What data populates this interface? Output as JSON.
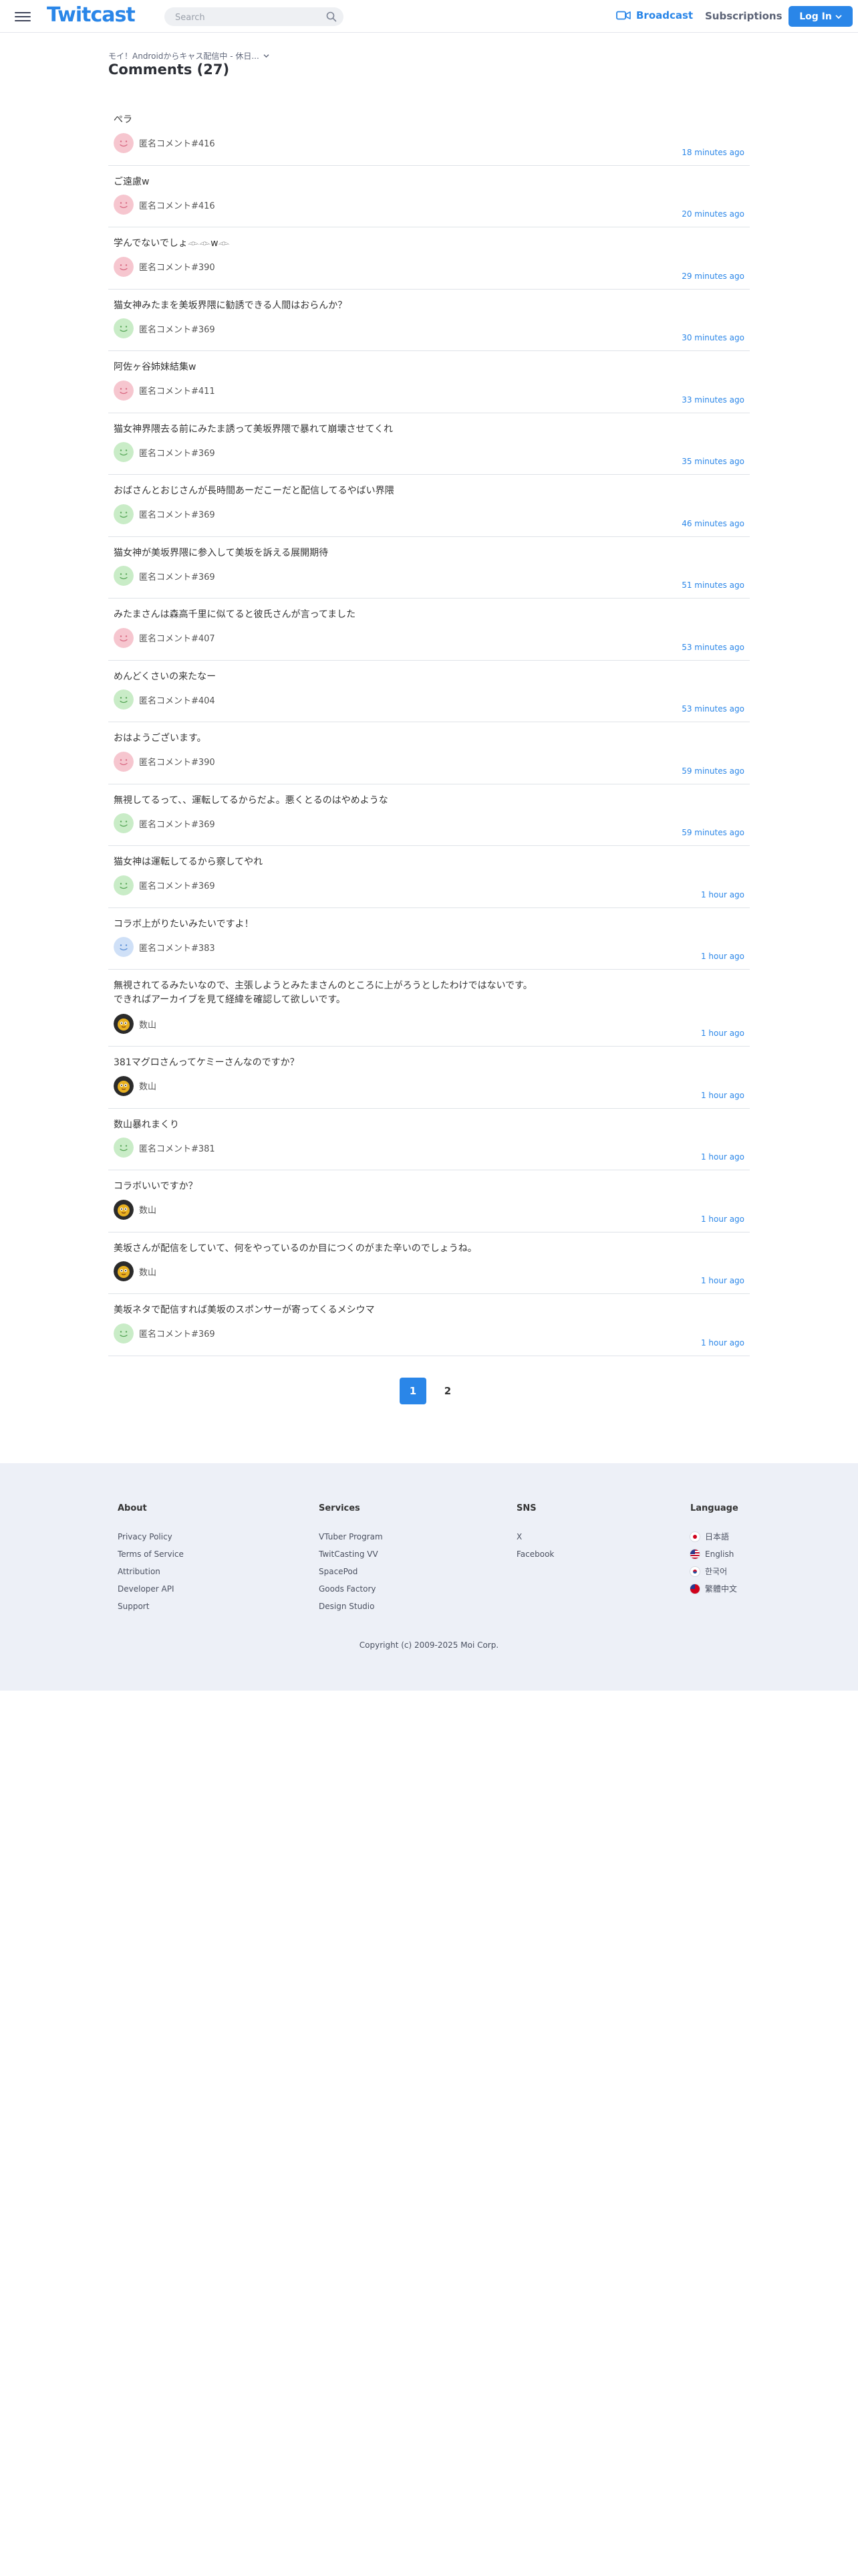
{
  "header": {
    "logo": "Twitcast",
    "search_placeholder": "Search",
    "broadcast": "Broadcast",
    "subscriptions": "Subscriptions",
    "login": "Log In"
  },
  "breadcrumb": "モイ！Androidからキャス配信中 - 休日...",
  "title": "Comments (27)",
  "comments": [
    {
      "text": "ぺラ",
      "user": "匿名コメント#416",
      "time": "18 minutes ago",
      "avatar": "pink"
    },
    {
      "text": "ご遠慮w",
      "user": "匿名コメント#416",
      "time": "20 minutes ago",
      "avatar": "pink"
    },
    {
      "text": "学んでないでしょ𓁹𓁹w𓁹",
      "user": "匿名コメント#390",
      "time": "29 minutes ago",
      "avatar": "pink"
    },
    {
      "text": "猫女神みたまを美坂界隈に勧誘できる人間はおらんか？",
      "user": "匿名コメント#369",
      "time": "30 minutes ago",
      "avatar": "green"
    },
    {
      "text": "阿佐ヶ谷姉妹結集w",
      "user": "匿名コメント#411",
      "time": "33 minutes ago",
      "avatar": "pink"
    },
    {
      "text": "猫女神界隈去る前にみたま誘って美坂界隈で暴れて崩壊させてくれ",
      "user": "匿名コメント#369",
      "time": "35 minutes ago",
      "avatar": "green"
    },
    {
      "text": "おばさんとおじさんが長時間あーだこーだと配信してるやばい界隈",
      "user": "匿名コメント#369",
      "time": "46 minutes ago",
      "avatar": "green"
    },
    {
      "text": "猫女神が美坂界隈に参入して美坂を訴える展開期待",
      "user": "匿名コメント#369",
      "time": "51 minutes ago",
      "avatar": "green"
    },
    {
      "text": "みたまさんは森高千里に似てると彼氏さんが言ってました",
      "user": "匿名コメント#407",
      "time": "53 minutes ago",
      "avatar": "pink"
    },
    {
      "text": "めんどくさいの来たなー",
      "user": "匿名コメント#404",
      "time": "53 minutes ago",
      "avatar": "green"
    },
    {
      "text": "おはようございます。",
      "user": "匿名コメント#390",
      "time": "59 minutes ago",
      "avatar": "pink"
    },
    {
      "text": "無視してるって、、運転してるからだよ。悪くとるのはやめような",
      "user": "匿名コメント#369",
      "time": "59 minutes ago",
      "avatar": "green"
    },
    {
      "text": "猫女神は運転してるから察してやれ",
      "user": "匿名コメント#369",
      "time": "1 hour ago",
      "avatar": "green"
    },
    {
      "text": "コラボ上がりたいみたいですよ！",
      "user": "匿名コメント#383",
      "time": "1 hour ago",
      "avatar": "blue"
    },
    {
      "text": "無視されてるみたいなので、主張しようとみたまさんのところに上がろうとしたわけではないです。\nできればアーカイブを見て経緯を確認して欲しいです。",
      "user": "数山",
      "time": "1 hour ago",
      "avatar": "photo",
      "tall": true
    },
    {
      "text": "381マグロさんってケミーさんなのですか？",
      "user": "数山",
      "time": "1 hour ago",
      "avatar": "photo"
    },
    {
      "text": "数山暴れまくり",
      "user": "匿名コメント#381",
      "time": "1 hour ago",
      "avatar": "green"
    },
    {
      "text": "コラボいいですか？",
      "user": "数山",
      "time": "1 hour ago",
      "avatar": "photo"
    },
    {
      "text": "美坂さんが配信をしていて、何をやっているのか目につくのがまた辛いのでしょうね。",
      "user": "数山",
      "time": "1 hour ago",
      "avatar": "photo"
    },
    {
      "text": "美坂ネタで配信すれば美坂のスポンサーが寄ってくるメシウマ",
      "user": "匿名コメント#369",
      "time": "1 hour ago",
      "avatar": "green"
    }
  ],
  "pagination": [
    "1",
    "2"
  ],
  "footer": {
    "about": {
      "heading": "About",
      "links": [
        "Privacy Policy",
        "Terms of Service",
        "Attribution",
        "Developer API",
        "Support"
      ]
    },
    "services": {
      "heading": "Services",
      "links": [
        "VTuber Program",
        "TwitCasting VV",
        "SpacePod",
        "Goods Factory",
        "Design Studio"
      ]
    },
    "sns": {
      "heading": "SNS",
      "links": [
        "X",
        "Facebook"
      ]
    },
    "language": {
      "heading": "Language",
      "links": [
        "日本語",
        "English",
        "한국어",
        "繁體中文"
      ]
    },
    "copyright": "Copyright (c) 2009-2025 Moi Corp."
  },
  "colors": {
    "accent": "#2a86e8",
    "footer_bg": "#edf0f7",
    "avatar_pink": "#f6c6cf",
    "avatar_green": "#c9ecc7",
    "avatar_blue": "#cfe0f7"
  }
}
